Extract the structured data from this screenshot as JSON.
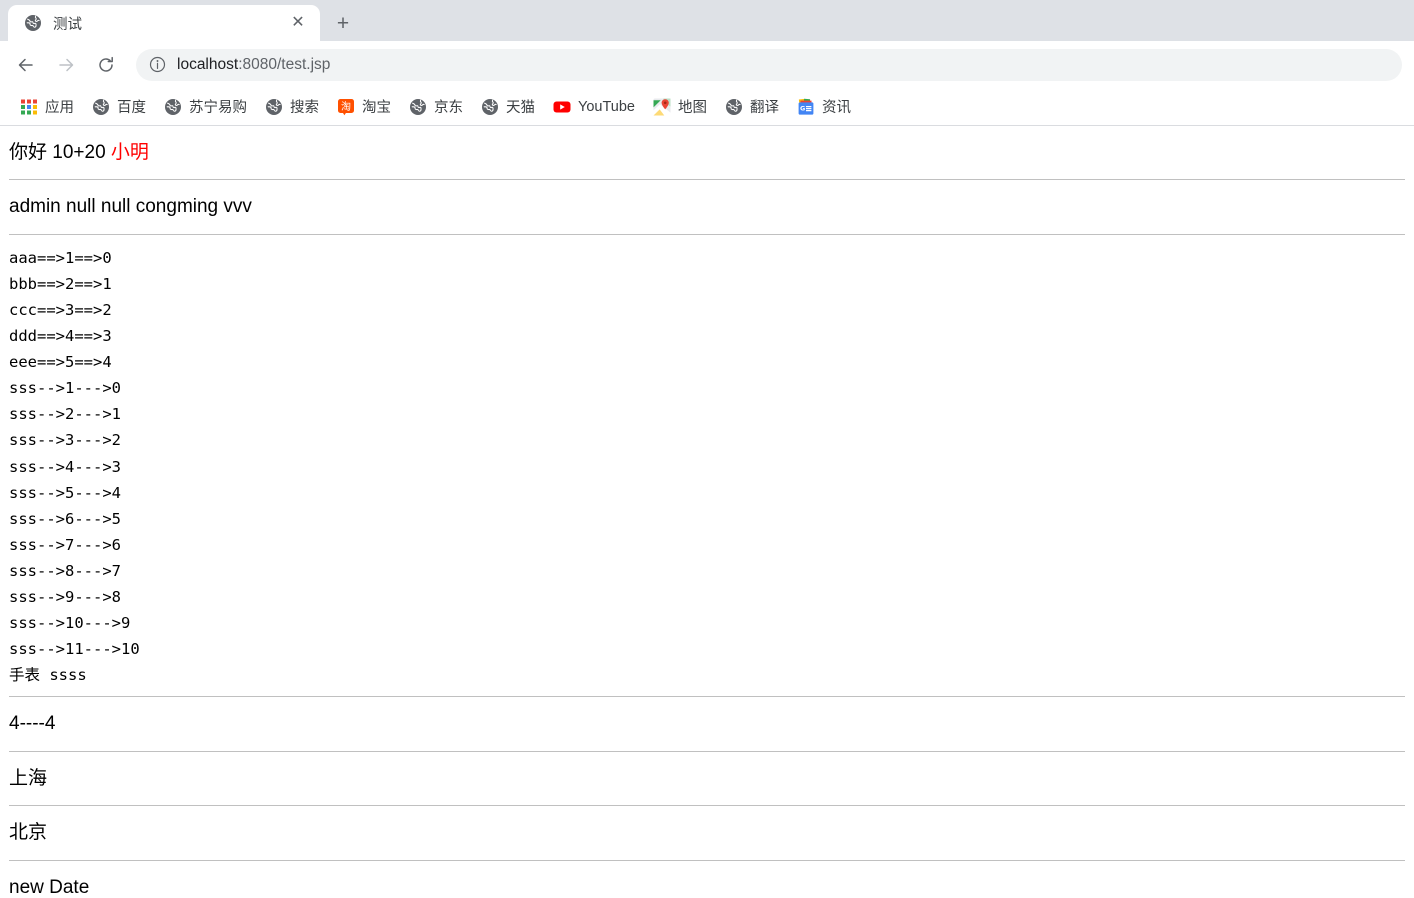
{
  "browser": {
    "tab": {
      "title": "测试",
      "favicon": "globe-icon",
      "close_label": "✕"
    },
    "newtab_label": "+",
    "nav": {
      "back_label": "←",
      "forward_label": "→",
      "reload_label": "⟳"
    },
    "omnibox": {
      "info_icon": "info-circle-icon",
      "host": "localhost",
      "path": ":8080/test.jsp",
      "full_url": "localhost:8080/test.jsp"
    },
    "bookmarks": [
      {
        "label": "应用",
        "icon": "apps-grid-icon"
      },
      {
        "label": "百度",
        "icon": "globe-icon"
      },
      {
        "label": "苏宁易购",
        "icon": "globe-icon"
      },
      {
        "label": "搜索",
        "icon": "globe-icon"
      },
      {
        "label": "淘宝",
        "icon": "taobao-icon"
      },
      {
        "label": "京东",
        "icon": "globe-icon"
      },
      {
        "label": "天猫",
        "icon": "globe-icon"
      },
      {
        "label": "YouTube",
        "icon": "youtube-icon"
      },
      {
        "label": "地图",
        "icon": "google-maps-icon"
      },
      {
        "label": "翻译",
        "icon": "globe-icon"
      },
      {
        "label": "资讯",
        "icon": "google-news-icon"
      }
    ]
  },
  "content": {
    "greeting": {
      "text": "你好 10+20 ",
      "name": "小明",
      "name_color": "#ff0000"
    },
    "user_line": "admin null null congming vvv",
    "list_block": "aaa==>1==>0\nbbb==>2==>1\nccc==>3==>2\nddd==>4==>3\neee==>5==>4\nsss-->1--->0\nsss-->2--->1\nsss-->3--->2\nsss-->4--->3\nsss-->5--->4\nsss-->6--->5\nsss-->7--->6\nsss-->8--->7\nsss-->9--->8\nsss-->10--->9\nsss-->11--->10\n手表 ssss",
    "count_line": "4----4",
    "city_1": "上海",
    "city_2": "北京",
    "date_line": "new Date"
  }
}
